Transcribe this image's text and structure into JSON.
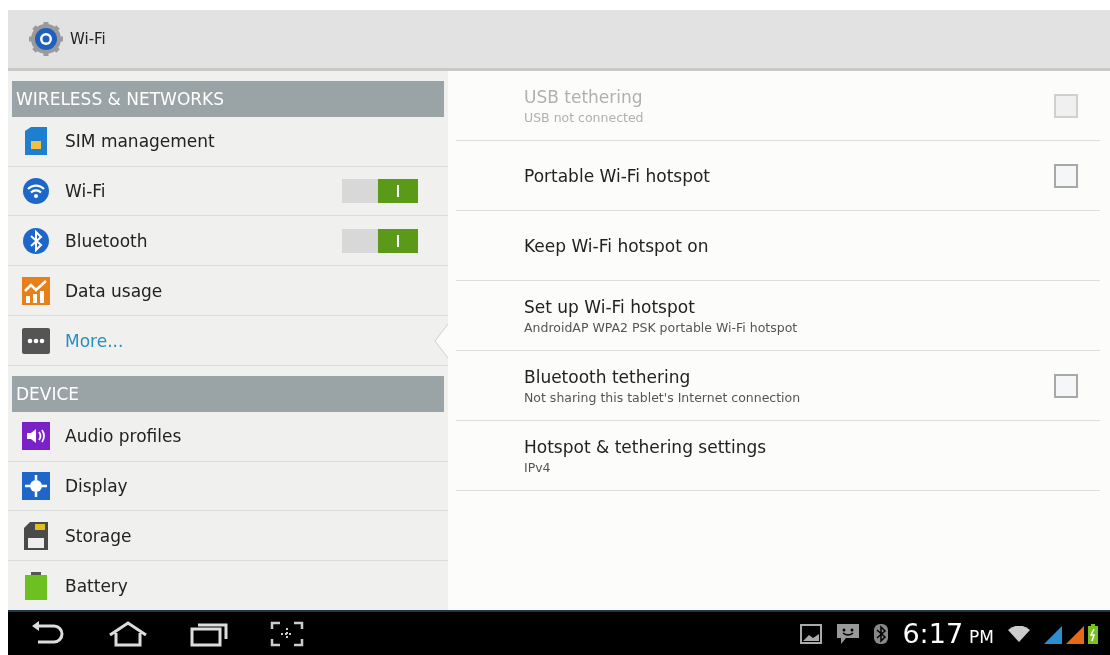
{
  "action_bar": {
    "title": "Wi-Fi"
  },
  "sidebar": {
    "sections": [
      {
        "header": "WIRELESS & NETWORKS",
        "items": [
          {
            "label": "SIM management",
            "kind": "plain",
            "selected": false
          },
          {
            "label": "Wi-Fi",
            "kind": "toggle",
            "on": true,
            "selected": false
          },
          {
            "label": "Bluetooth",
            "kind": "toggle",
            "on": true,
            "selected": false
          },
          {
            "label": "Data usage",
            "kind": "plain",
            "selected": false
          },
          {
            "label": "More...",
            "kind": "plain",
            "selected": true
          }
        ]
      },
      {
        "header": "DEVICE",
        "items": [
          {
            "label": "Audio profiles",
            "kind": "plain",
            "selected": false
          },
          {
            "label": "Display",
            "kind": "plain",
            "selected": false
          },
          {
            "label": "Storage",
            "kind": "plain",
            "selected": false
          },
          {
            "label": "Battery",
            "kind": "plain",
            "selected": false
          }
        ]
      }
    ]
  },
  "preferences": [
    {
      "title": "USB tethering",
      "summary": "USB not connected",
      "kind": "checkbox",
      "checked": false,
      "disabled": true
    },
    {
      "title": "Portable Wi-Fi hotspot",
      "kind": "checkbox",
      "checked": false,
      "disabled": false
    },
    {
      "title": "Keep Wi-Fi hotspot on",
      "kind": "plain",
      "disabled": false
    },
    {
      "title": "Set up Wi-Fi hotspot",
      "summary": "AndroidAP WPA2 PSK portable Wi-Fi hotspot",
      "kind": "plain",
      "disabled": false
    },
    {
      "title": "Bluetooth tethering",
      "summary": "Not sharing this tablet's Internet connection",
      "kind": "checkbox",
      "checked": false,
      "disabled": false
    },
    {
      "title": "Hotspot & tethering settings",
      "summary": "IPv4",
      "kind": "plain",
      "disabled": false
    }
  ],
  "status_bar": {
    "time": "6:17",
    "meridiem": "PM"
  }
}
